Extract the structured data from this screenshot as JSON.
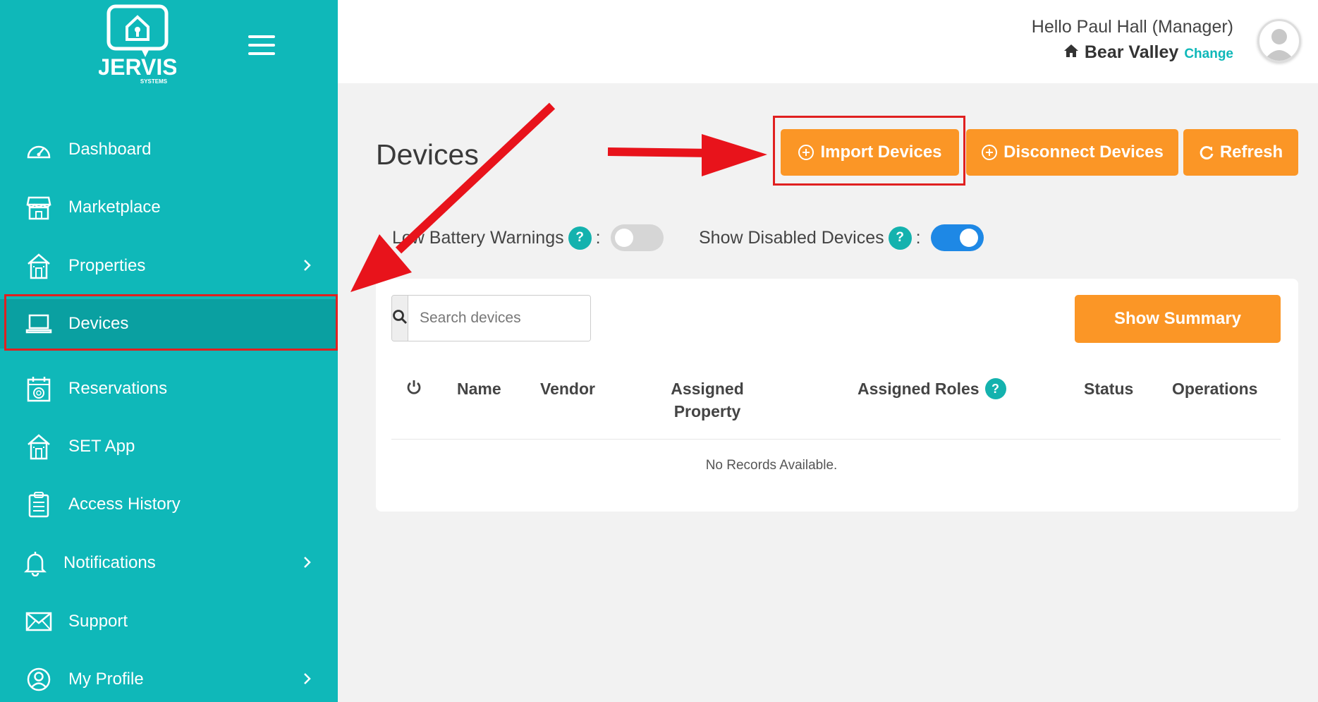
{
  "brand": {
    "name": "JERVIS",
    "sub": "SYSTEMS"
  },
  "sidebar": {
    "items": [
      {
        "label": "Dashboard",
        "icon": "dashboard-gauge-icon",
        "has_chevron": false
      },
      {
        "label": "Marketplace",
        "icon": "storefront-icon",
        "has_chevron": false
      },
      {
        "label": "Properties",
        "icon": "building-icon",
        "has_chevron": true
      },
      {
        "label": "Devices",
        "icon": "laptop-icon",
        "has_chevron": false,
        "active": true
      },
      {
        "label": "Reservations",
        "icon": "calendar-icon",
        "has_chevron": false
      },
      {
        "label": "SET App",
        "icon": "building-icon",
        "has_chevron": false
      },
      {
        "label": "Access History",
        "icon": "clipboard-icon",
        "has_chevron": false
      },
      {
        "label": "Notifications",
        "icon": "bell-icon",
        "has_chevron": true
      },
      {
        "label": "Support",
        "icon": "envelope-icon",
        "has_chevron": false
      },
      {
        "label": "My Profile",
        "icon": "user-circle-icon",
        "has_chevron": true
      }
    ]
  },
  "header": {
    "greeting": "Hello Paul Hall (Manager)",
    "property": "Bear Valley",
    "change_label": "Change"
  },
  "main": {
    "title": "Devices",
    "buttons": {
      "import": "Import Devices",
      "disconnect": "Disconnect Devices",
      "refresh": "Refresh"
    },
    "toggles": {
      "low_battery_label": "Low Battery Warnings",
      "low_battery_on": false,
      "show_disabled_label": "Show Disabled Devices",
      "show_disabled_on": true,
      "help_mark": "?",
      "separator": ":"
    },
    "search": {
      "placeholder": "Search devices"
    },
    "summary_button": "Show Summary",
    "table": {
      "columns": {
        "name": "Name",
        "vendor": "Vendor",
        "assigned_property_1": "Assigned",
        "assigned_property_2": "Property",
        "assigned_roles": "Assigned Roles",
        "status": "Status",
        "operations": "Operations"
      },
      "empty_text": "No Records Available."
    }
  },
  "colors": {
    "sidebar": "#0fb8b9",
    "accent_orange": "#fb9626",
    "annotation_red": "#e02020",
    "toggle_on": "#1e88e5"
  }
}
